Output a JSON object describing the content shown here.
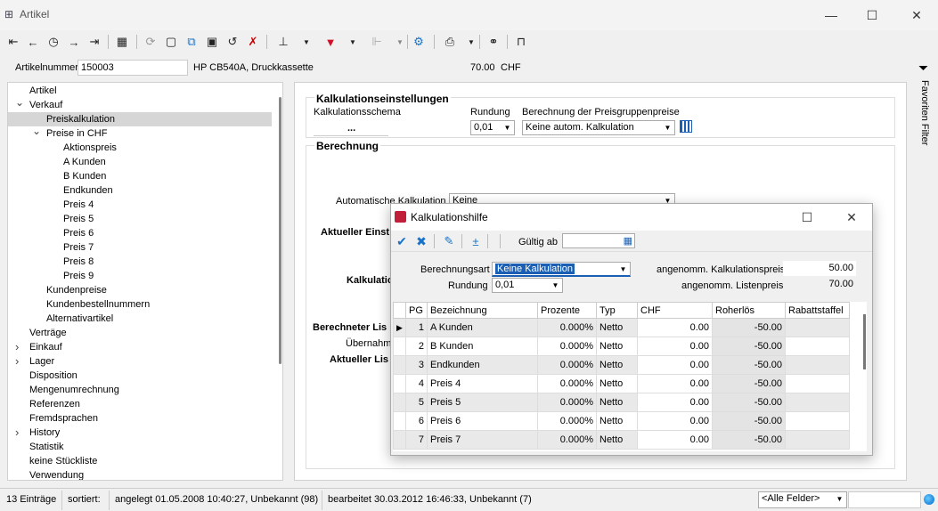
{
  "window": {
    "title": "Artikel"
  },
  "article": {
    "label": "Artikelnummer",
    "number": "150003",
    "description": "HP CB540A, Druckkassette",
    "price": "70.00",
    "currency": "CHF"
  },
  "sidebar_right": {
    "label": "Favoriten Filter"
  },
  "tree": [
    {
      "label": "Artikel",
      "level": 1
    },
    {
      "label": "Verkauf",
      "level": 1,
      "expanded": true
    },
    {
      "label": "Preiskalkulation",
      "level": 2,
      "selected": true
    },
    {
      "label": "Preise in CHF",
      "level": 2,
      "expanded": true
    },
    {
      "label": "Aktionspreis",
      "level": 3
    },
    {
      "label": "A Kunden",
      "level": 3
    },
    {
      "label": "B Kunden",
      "level": 3
    },
    {
      "label": "Endkunden",
      "level": 3
    },
    {
      "label": "Preis 4",
      "level": 3
    },
    {
      "label": "Preis 5",
      "level": 3
    },
    {
      "label": "Preis 6",
      "level": 3
    },
    {
      "label": "Preis 7",
      "level": 3
    },
    {
      "label": "Preis 8",
      "level": 3
    },
    {
      "label": "Preis 9",
      "level": 3
    },
    {
      "label": "Kundenpreise",
      "level": 2
    },
    {
      "label": "Kundenbestellnummern",
      "level": 2
    },
    {
      "label": "Alternativartikel",
      "level": 2
    },
    {
      "label": "Verträge",
      "level": 1
    },
    {
      "label": "Einkauf",
      "level": 1,
      "collapsed": true
    },
    {
      "label": "Lager",
      "level": 1,
      "collapsed": true
    },
    {
      "label": "Disposition",
      "level": 1
    },
    {
      "label": "Mengenumrechnung",
      "level": 1
    },
    {
      "label": "Referenzen",
      "level": 1
    },
    {
      "label": "Fremdsprachen",
      "level": 1
    },
    {
      "label": "History",
      "level": 1,
      "collapsed": true
    },
    {
      "label": "Statistik",
      "level": 1
    },
    {
      "label": "keine Stückliste",
      "level": 1
    },
    {
      "label": "Verwendung",
      "level": 1
    }
  ],
  "main": {
    "kalk_title": "Kalkulationseinstellungen",
    "schema_label": "Kalkulationsschema",
    "schema_btn": "...",
    "rundung_label": "Rundung",
    "rundung_value": "0,01",
    "pg_label": "Berechnung der Preisgruppenpreise",
    "pg_value": "Keine autom. Kalkulation",
    "berechnung_title": "Berechnung",
    "auto_label": "Automatische Kalkulation",
    "auto_value": "Keine",
    "aktueller_ein": "Aktueller Einst",
    "kalkulatio": "Kalkulatio",
    "berechneter": "Berechneter Lis",
    "uebernahme": "Übernahme",
    "aktueller_lis": "Aktueller Lis"
  },
  "dialog": {
    "title": "Kalkulationshilfe",
    "gueltig_label": "Gültig ab",
    "berechnungsart_label": "Berechnungsart",
    "berechnungsart_value": "Keine Kalkulation",
    "rundung_label": "Rundung",
    "rundung_value": "0,01",
    "kalkpreis_label": "angenomm. Kalkulationspreis",
    "kalkpreis_value": "50.00",
    "listenpreis_label": "angenomm. Listenpreis",
    "listenpreis_value": "70.00",
    "columns": [
      "PG",
      "Bezeichnung",
      "Prozente",
      "Typ",
      "CHF",
      "Roherlös",
      "Rabattstaffel"
    ],
    "rows": [
      {
        "pg": "1",
        "bez": "A Kunden",
        "proz": "0.000%",
        "typ": "Netto",
        "chf": "0.00",
        "roh": "-50.00",
        "current": true
      },
      {
        "pg": "2",
        "bez": "B Kunden",
        "proz": "0.000%",
        "typ": "Netto",
        "chf": "0.00",
        "roh": "-50.00"
      },
      {
        "pg": "3",
        "bez": "Endkunden",
        "proz": "0.000%",
        "typ": "Netto",
        "chf": "0.00",
        "roh": "-50.00"
      },
      {
        "pg": "4",
        "bez": "Preis 4",
        "proz": "0.000%",
        "typ": "Netto",
        "chf": "0.00",
        "roh": "-50.00"
      },
      {
        "pg": "5",
        "bez": "Preis 5",
        "proz": "0.000%",
        "typ": "Netto",
        "chf": "0.00",
        "roh": "-50.00"
      },
      {
        "pg": "6",
        "bez": "Preis 6",
        "proz": "0.000%",
        "typ": "Netto",
        "chf": "0.00",
        "roh": "-50.00"
      },
      {
        "pg": "7",
        "bez": "Preis 7",
        "proz": "0.000%",
        "typ": "Netto",
        "chf": "0.00",
        "roh": "-50.00"
      }
    ]
  },
  "status": {
    "count": "13 Einträge",
    "sorted": "sortiert:",
    "created": "angelegt 01.05.2008 10:40:27, Unbekannt (98)",
    "edited": "bearbeitet 30.03.2012 16:46:33, Unbekannt (7)",
    "field_filter": "<Alle Felder>"
  }
}
